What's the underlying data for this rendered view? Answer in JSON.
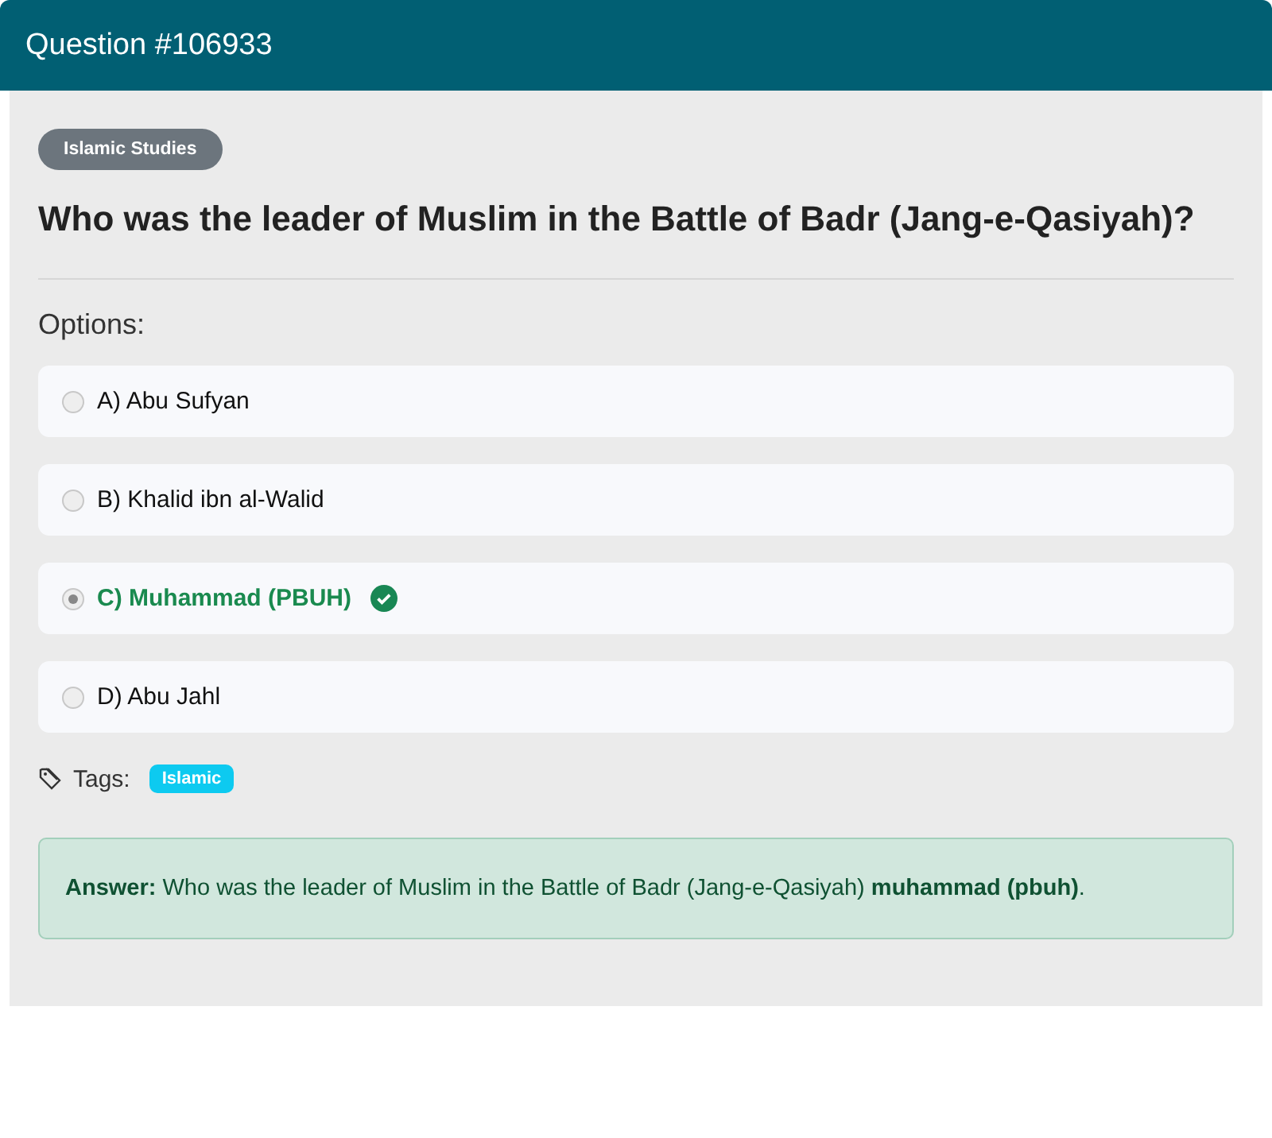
{
  "header": {
    "title": "Question #106933"
  },
  "category": "Islamic Studies",
  "question": "Who was the leader of Muslim in the Battle of Badr (Jang-e-Qasiyah)?",
  "options_label": "Options:",
  "options": [
    {
      "label": "A) Abu Sufyan",
      "selected": false,
      "correct": false
    },
    {
      "label": "B) Khalid ibn al-Walid",
      "selected": false,
      "correct": false
    },
    {
      "label": "C) Muhammad (PBUH)",
      "selected": true,
      "correct": true
    },
    {
      "label": "D) Abu Jahl",
      "selected": false,
      "correct": false
    }
  ],
  "tags_label": "Tags:",
  "tags": [
    "Islamic"
  ],
  "answer": "**Answer:** Who was the leader of Muslim in the Battle of Badr (Jang-e-Qasiyah) **muhammad (pbuh)**."
}
